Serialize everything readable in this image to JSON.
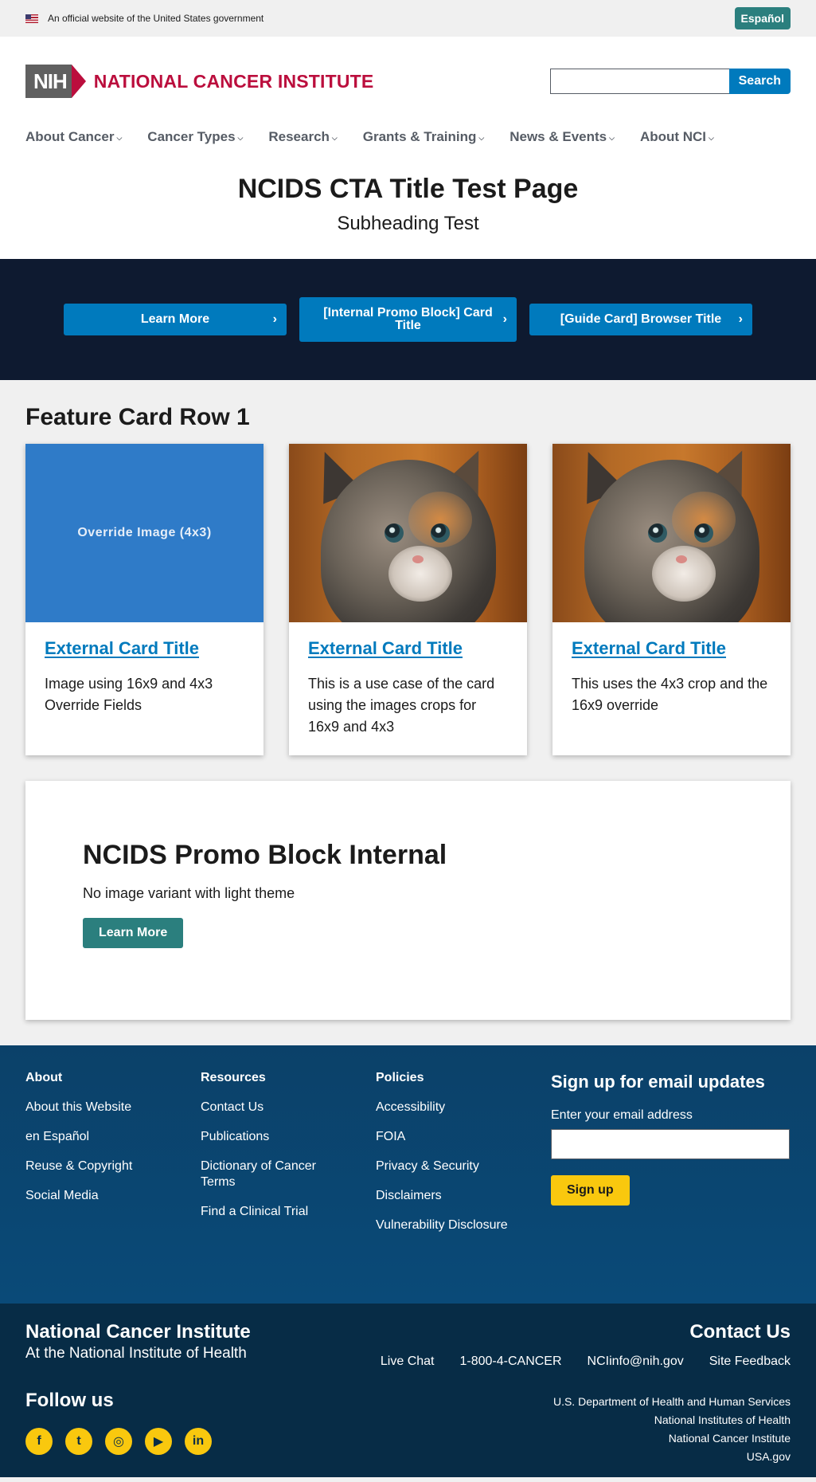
{
  "gov_banner": {
    "text": "An official website of the United States government",
    "espanol": "Español"
  },
  "header": {
    "nih": "NIH",
    "institute": "NATIONAL CANCER INSTITUTE",
    "search_button": "Search",
    "search_placeholder": ""
  },
  "nav": [
    {
      "label": "About Cancer"
    },
    {
      "label": "Cancer Types"
    },
    {
      "label": "Research"
    },
    {
      "label": "Grants & Training"
    },
    {
      "label": "News & Events"
    },
    {
      "label": "About NCI"
    }
  ],
  "page": {
    "title": "NCIDS CTA Title Test Page",
    "subtitle": "Subheading Test"
  },
  "cta": {
    "btn1": "Learn More",
    "btn2": "[Internal Promo Block] Card Title",
    "btn3": "[Guide Card] Browser Title"
  },
  "features": {
    "title": "Feature Card Row 1",
    "cards": [
      {
        "image_text": "Override Image (4x3)",
        "title": "External Card Title",
        "text": "Image using 16x9 and 4x3 Override Fields"
      },
      {
        "title": "External Card Title",
        "text": "This is a use case of the card using the images crops for 16x9 and 4x3"
      },
      {
        "title": "External Card Title",
        "text": "This uses the 4x3 crop and the 16x9 override"
      }
    ]
  },
  "promo": {
    "title": "NCIDS Promo Block Internal",
    "text": "No image variant with light theme",
    "button": "Learn More"
  },
  "footer": {
    "about": {
      "heading": "About",
      "links": [
        "About this Website",
        "en Español",
        "Reuse & Copyright",
        "Social Media"
      ]
    },
    "resources": {
      "heading": "Resources",
      "links": [
        "Contact Us",
        "Publications",
        "Dictionary of Cancer Terms",
        "Find a Clinical Trial"
      ]
    },
    "policies": {
      "heading": "Policies",
      "links": [
        "Accessibility",
        "FOIA",
        "Privacy & Security",
        "Disclaimers",
        "Vulnerability Disclosure"
      ]
    },
    "signup": {
      "title": "Sign up for email updates",
      "label": "Enter your email address",
      "button": "Sign up"
    }
  },
  "footer_secondary": {
    "institute": "National Cancer Institute",
    "institute_sub": "At the National Institute of Health",
    "follow": "Follow us",
    "socials": [
      {
        "icon": "facebook-icon",
        "glyph": "f"
      },
      {
        "icon": "twitter-icon",
        "glyph": "t"
      },
      {
        "icon": "instagram-icon",
        "glyph": "◎"
      },
      {
        "icon": "youtube-icon",
        "glyph": "▶"
      },
      {
        "icon": "linkedin-icon",
        "glyph": "in"
      }
    ],
    "contact_title": "Contact Us",
    "contact_links": [
      "Live Chat",
      "1-800-4-CANCER",
      "NCIinfo@nih.gov",
      "Site Feedback"
    ],
    "agencies": [
      "U.S. Department of Health and Human Services",
      "National Institutes of Health",
      "National Cancer Institute",
      "USA.gov"
    ]
  },
  "colors": {
    "brand_red": "#bb0e3d",
    "primary_blue": "#007abd",
    "teal": "#2b7f7e",
    "navy": "#0e1a30",
    "footer_blue": "#0b4169",
    "footer_dark": "#072c46",
    "accent_yellow": "#f9c80e"
  }
}
